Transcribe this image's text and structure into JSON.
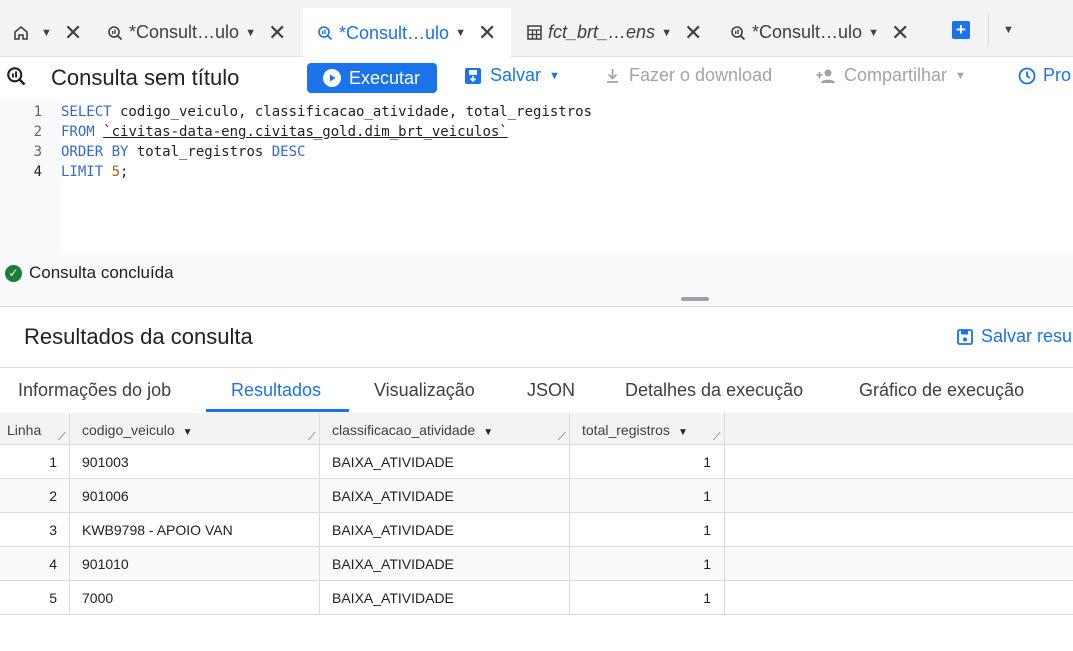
{
  "tabs": [
    {
      "label": "",
      "icon": "home-icon"
    },
    {
      "label": "*Consult…ulo",
      "icon": "query-icon"
    },
    {
      "label": "*Consult…ulo",
      "icon": "query-icon",
      "active": true
    },
    {
      "label": "fct_brt_…ens",
      "icon": "table-icon"
    },
    {
      "label": "*Consult…ulo",
      "icon": "query-icon"
    }
  ],
  "toolbar": {
    "title": "Consulta sem título",
    "run_label": "Executar",
    "save_label": "Salvar",
    "download_label": "Fazer o download",
    "share_label": "Compartilhar",
    "schedule_label": "Pro"
  },
  "editor": {
    "line_numbers": [
      "1",
      "2",
      "3",
      "4"
    ],
    "lines": {
      "l1": {
        "kw": "SELECT",
        "rest": " codigo_veiculo, classificacao_atividade, total_registros"
      },
      "l2": {
        "kw": "FROM",
        "table": "`civitas-data-eng.civitas_gold.dim_brt_veiculos`"
      },
      "l3": {
        "kw1": "ORDER BY",
        "mid": " total_registros ",
        "kw2": "DESC"
      },
      "l4": {
        "kw": "LIMIT",
        "num": "5",
        "end": ";"
      }
    }
  },
  "status": {
    "text": "Consulta concluída"
  },
  "results": {
    "title": "Resultados da consulta",
    "save_label": "Salvar resu",
    "tabs": [
      "Informações do job",
      "Resultados",
      "Visualização",
      "JSON",
      "Detalhes da execução",
      "Gráfico de execução"
    ],
    "active_tab": "Resultados",
    "columns": [
      "Linha",
      "codigo_veiculo",
      "classificacao_atividade",
      "total_registros"
    ],
    "rows": [
      [
        "1",
        "901003",
        "BAIXA_ATIVIDADE",
        "1"
      ],
      [
        "2",
        "901006",
        "BAIXA_ATIVIDADE",
        "1"
      ],
      [
        "3",
        "KWB9798 - APOIO VAN",
        "BAIXA_ATIVIDADE",
        "1"
      ],
      [
        "4",
        "901010",
        "BAIXA_ATIVIDADE",
        "1"
      ],
      [
        "5",
        "7000",
        "BAIXA_ATIVIDADE",
        "1"
      ]
    ]
  },
  "colors": {
    "accent": "#1a73e8",
    "success": "#188038",
    "keyword": "#3367d6",
    "number": "#b06000"
  }
}
